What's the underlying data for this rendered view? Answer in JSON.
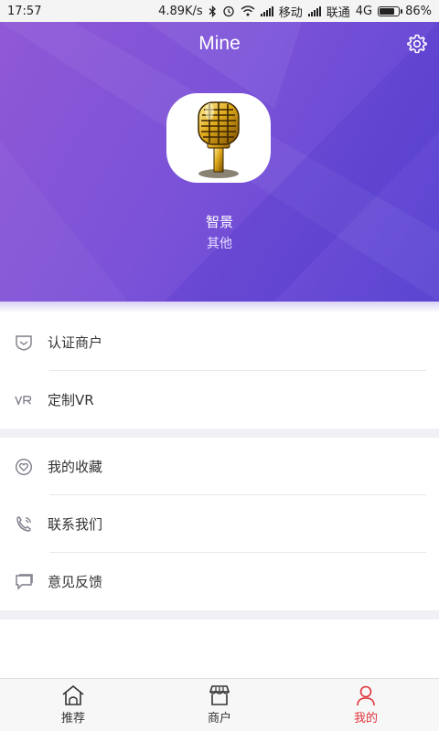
{
  "status_bar": {
    "time": "17:57",
    "network_speed": "4.89K/s",
    "carrier1": "移动",
    "carrier2": "联通",
    "network_type": "4G",
    "battery": "86%",
    "battery_level": 0.86
  },
  "header": {
    "title": "Mine",
    "settings_icon": "gear-icon"
  },
  "profile": {
    "name": "智景",
    "category": "其他",
    "avatar_icon": "microphone-icon"
  },
  "menu_groups": [
    {
      "items": [
        {
          "label": "认证商户",
          "icon": "shield-icon"
        },
        {
          "label": "定制VR",
          "icon": "vr-icon"
        }
      ]
    },
    {
      "items": [
        {
          "label": "我的收藏",
          "icon": "heart-icon"
        },
        {
          "label": "联系我们",
          "icon": "phone-icon"
        },
        {
          "label": "意见反馈",
          "icon": "feedback-icon"
        }
      ]
    }
  ],
  "tabs": [
    {
      "label": "推荐",
      "icon": "home-icon",
      "active": false
    },
    {
      "label": "商户",
      "icon": "store-icon",
      "active": false
    },
    {
      "label": "我的",
      "icon": "user-icon",
      "active": true
    }
  ],
  "colors": {
    "header_gradient_start": "#9058d6",
    "header_gradient_end": "#5a45d2",
    "active_tab": "#e0333a"
  }
}
